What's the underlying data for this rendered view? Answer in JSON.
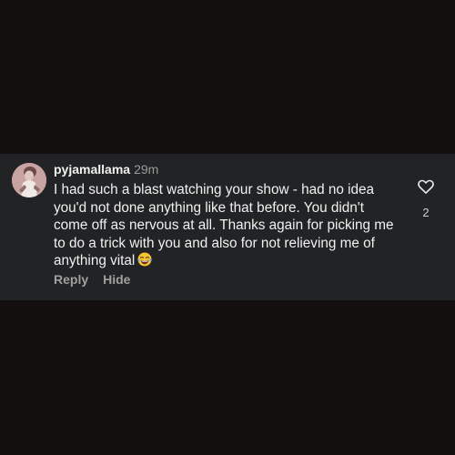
{
  "comment": {
    "username": "pyjamallama",
    "time": "29m",
    "text": "I had such a blast watching your show - had no idea you'd not done anything like that before. You didn't come off as nervous at all. Thanks again for picking me to do a trick with you and also for not relieving me of anything vital",
    "emoji": "rolling-on-floor-laughing-emoji",
    "like_count": "2",
    "reply_label": "Reply",
    "hide_label": "Hide"
  },
  "colors": {
    "background": "#130f0e",
    "card": "#212325",
    "text": "#f1f1f1",
    "muted": "#9a9a9a"
  },
  "icons": {
    "like": "heart-outline-icon",
    "avatar": "profile-photo"
  }
}
